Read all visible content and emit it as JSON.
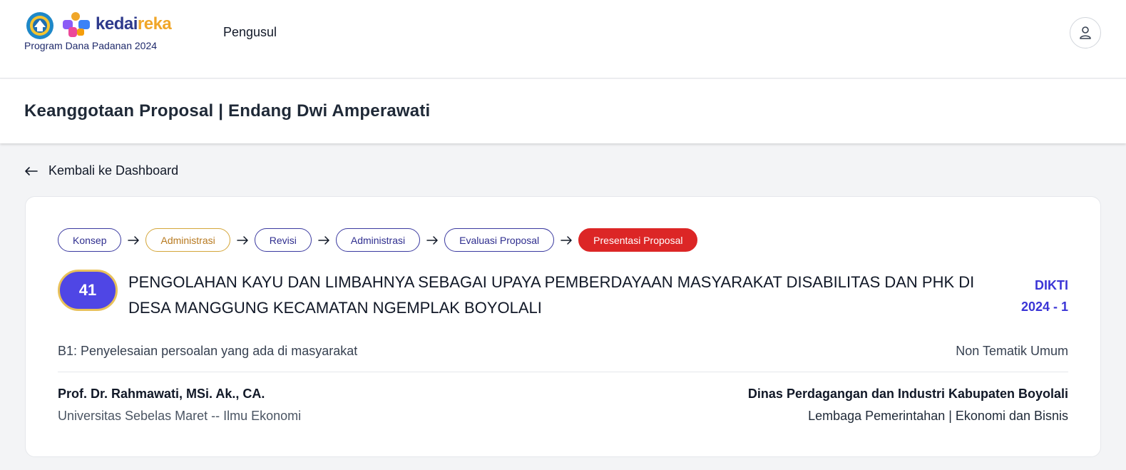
{
  "header": {
    "brand_part1": "kedai",
    "brand_part2": "reka",
    "program_label": "Program Dana Padanan 2024",
    "nav_item": "Pengusul",
    "icons": [
      "kemdikbud-logo-icon",
      "kedaireka-logo-icon",
      "user-icon"
    ]
  },
  "page": {
    "title": "Keanggotaan Proposal | Endang Dwi Amperawati",
    "back_label": "Kembali ke Dashboard"
  },
  "proposal": {
    "steps": [
      {
        "label": "Konsep",
        "style": "indigo"
      },
      {
        "label": "Administrasi",
        "style": "amber"
      },
      {
        "label": "Revisi",
        "style": "indigo"
      },
      {
        "label": "Administrasi",
        "style": "indigo"
      },
      {
        "label": "Evaluasi Proposal",
        "style": "indigo"
      },
      {
        "label": "Presentasi Proposal",
        "style": "red"
      }
    ],
    "number": "41",
    "title": "PENGOLAHAN KAYU DAN LIMBAHNYA SEBAGAI UPAYA PEMBERDAYAAN MASYARAKAT DISABILITAS DAN PHK DI DESA MANGGUNG KECAMATAN NGEMPLAK BOYOLALI",
    "scheme_line1": "DIKTI",
    "scheme_line2": "2024 - 1",
    "category": "B1: Penyelesaian persoalan yang ada di masyarakat",
    "theme": "Non Tematik Umum",
    "leader_name": "Prof. Dr. Rahmawati, MSi. Ak., CA.",
    "leader_affiliation": "Universitas Sebelas Maret -- Ilmu Ekonomi",
    "partner_name": "Dinas Perdagangan dan Industri Kabupaten Boyolali",
    "partner_affiliation": "Lembaga Pemerintahan | Ekonomi dan Bisnis"
  },
  "colors": {
    "accent_indigo": "#4f46e5",
    "status_red": "#dc2626",
    "step_amber": "#d4a63a",
    "scheme_blue": "#3b35d6"
  }
}
